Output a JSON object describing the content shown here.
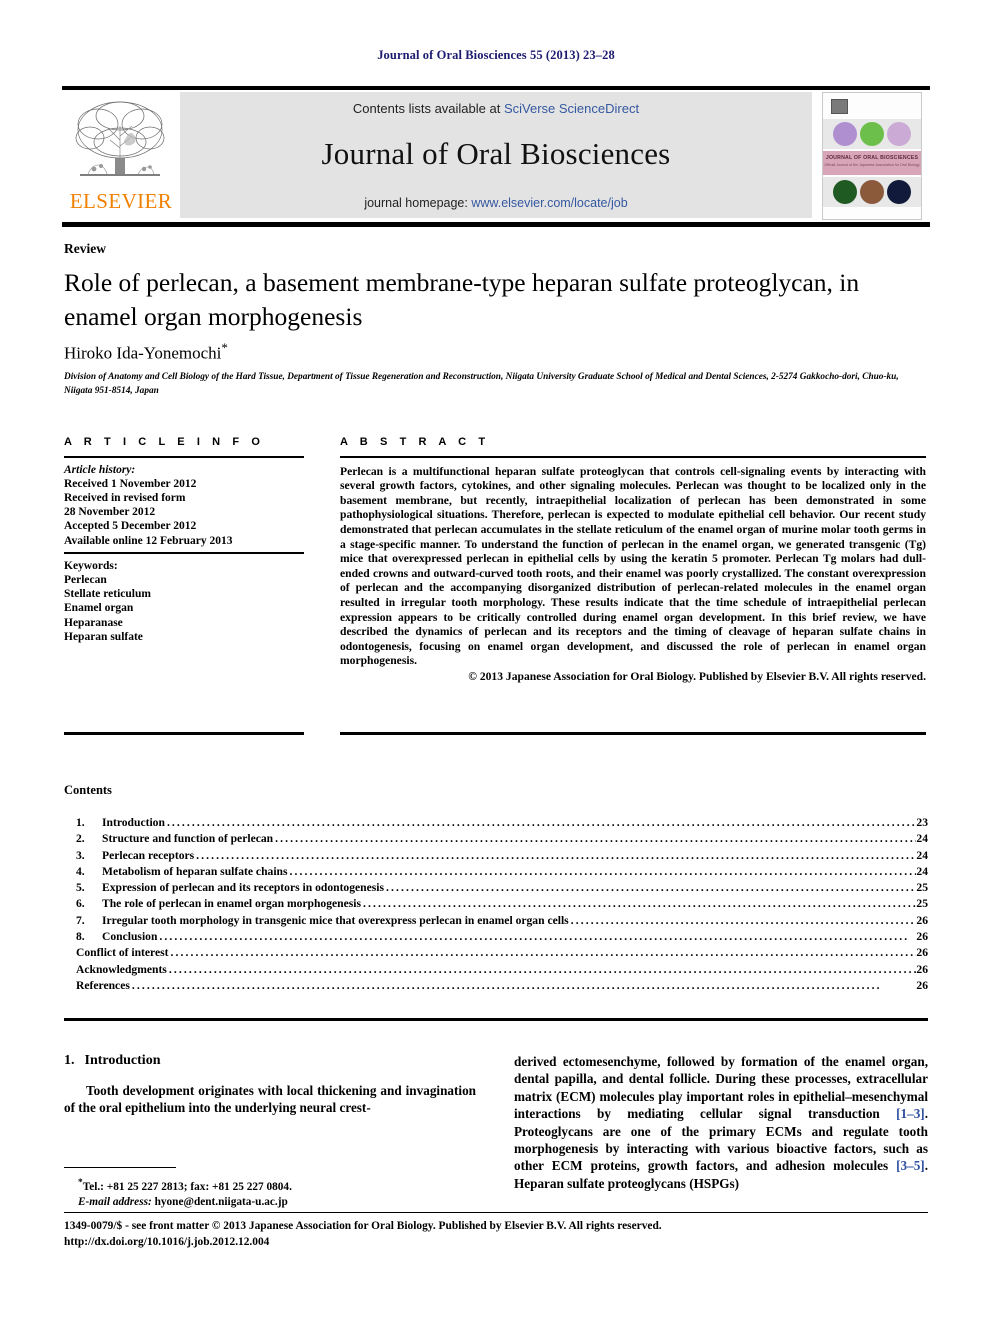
{
  "running_head": "Journal of Oral Biosciences 55 (2013) 23–28",
  "masthead": {
    "contents_prefix": "Contents lists available at ",
    "sciencedirect_link": "SciVerse ScienceDirect",
    "journal_title": "Journal of Oral Biosciences",
    "homepage_prefix": "journal homepage: ",
    "homepage_link": "www.elsevier.com/locate/job",
    "publisher_wordmark": "ELSEVIER",
    "publisher_color": "#f08000",
    "banner_bg": "#e3e3e3",
    "cover_caption": "JOURNAL OF ORAL BIOSCIENCES",
    "cover_caption_sub": "Official Journal of the Japanese Association for Oral Biology"
  },
  "article": {
    "type_label": "Review",
    "title": "Role of perlecan, a basement membrane-type heparan sulfate proteoglycan, in enamel organ morphogenesis",
    "author": "Hiroko Ida-Yonemochi",
    "author_marker": "*",
    "affiliation": "Division of Anatomy and Cell Biology of the Hard Tissue, Department of Tissue Regeneration and Reconstruction, Niigata University Graduate School of Medical and Dental Sciences, 2-5274 Gakkocho-dori, Chuo-ku, Niigata 951-8514, Japan"
  },
  "article_info": {
    "heading": "A R T I C L E   I N F O",
    "history_label": "Article history:",
    "history_lines": [
      "Received 1 November 2012",
      "Received in revised form",
      "28 November 2012",
      "Accepted 5 December 2012",
      "Available online 12 February 2013"
    ],
    "keywords_label": "Keywords:",
    "keywords": [
      "Perlecan",
      "Stellate reticulum",
      "Enamel organ",
      "Heparanase",
      "Heparan sulfate"
    ]
  },
  "abstract": {
    "heading": "A B S T R A C T",
    "body": "Perlecan is a multifunctional heparan sulfate proteoglycan that controls cell-signaling events by interacting with several growth factors, cytokines, and other signaling molecules. Perlecan was thought to be localized only in the basement membrane, but recently, intraepithelial localization of perlecan has been demonstrated in some pathophysiological situations. Therefore, perlecan is expected to modulate epithelial cell behavior. Our recent study demonstrated that perlecan accumulates in the stellate reticulum of the enamel organ of murine molar tooth germs in a stage-specific manner. To understand the function of perlecan in the enamel organ, we generated transgenic (Tg) mice that overexpressed perlecan in epithelial cells by using the keratin 5 promoter. Perlecan Tg molars had dull-ended crowns and outward-curved tooth roots, and their enamel was poorly crystallized. The constant overexpression of perlecan and the accompanying disorganized distribution of perlecan-related molecules in the enamel organ resulted in irregular tooth morphology. These results indicate that the time schedule of intraepithelial perlecan expression appears to be critically controlled during enamel organ development. In this brief review, we have described the dynamics of perlecan and its receptors and the timing of cleavage of heparan sulfate chains in odontogenesis, focusing on enamel organ development, and discussed the role of perlecan in enamel organ morphogenesis.",
    "copyright": "© 2013 Japanese Association for Oral Biology. Published by Elsevier B.V. All rights reserved."
  },
  "contents": {
    "heading": "Contents",
    "entries": [
      {
        "num": "1.",
        "label": "Introduction",
        "page": "23"
      },
      {
        "num": "2.",
        "label": "Structure and function of perlecan",
        "page": "24"
      },
      {
        "num": "3.",
        "label": "Perlecan receptors",
        "page": "24"
      },
      {
        "num": "4.",
        "label": "Metabolism of heparan sulfate chains",
        "page": "24"
      },
      {
        "num": "5.",
        "label": "Expression of perlecan and its receptors in odontogenesis",
        "page": "25"
      },
      {
        "num": "6.",
        "label": "The role of perlecan in enamel organ morphogenesis",
        "page": "25"
      },
      {
        "num": "7.",
        "label": "Irregular tooth morphology in transgenic mice that overexpress perlecan in enamel organ cells",
        "page": "26"
      },
      {
        "num": "8.",
        "label": "Conclusion",
        "page": "26"
      },
      {
        "num": "",
        "label": "Conflict of interest",
        "page": "26"
      },
      {
        "num": "",
        "label": "Acknowledgments",
        "page": "26"
      },
      {
        "num": "",
        "label": "References",
        "page": "26"
      }
    ]
  },
  "introduction": {
    "number": "1.",
    "heading": "Introduction",
    "paragraph_left": "Tooth development originates with local thickening and invagination of the oral epithelium into the underlying neural crest-",
    "paragraph_right_a": "derived ectomesenchyme, followed by formation of the enamel organ, dental papilla, and dental follicle. During these processes, extracellular matrix (ECM) molecules play important roles in epithelial–mesenchymal interactions by mediating cellular signal transduction ",
    "ref_1": "[1–3]",
    "paragraph_right_b": ". Proteoglycans are one of the primary ECMs and regulate tooth morphogenesis by interacting with various bioactive factors, such as other ECM proteins, growth factors, and adhesion molecules ",
    "ref_2": "[3–5]",
    "paragraph_right_c": ". Heparan sulfate proteoglycans (HSPGs)"
  },
  "footnote": {
    "marker": "*",
    "tel": "Tel.: +81 25 227 2813; fax: +81 25 227 0804.",
    "email_label": "E-mail address:",
    "email": "hyone@dent.niigata-u.ac.jp"
  },
  "footer": {
    "issn_line": "1349-0079/$ - see front matter © 2013 Japanese Association for Oral Biology. Published by Elsevier B.V. All rights reserved.",
    "doi": "http://dx.doi.org/10.1016/j.job.2012.12.004"
  }
}
